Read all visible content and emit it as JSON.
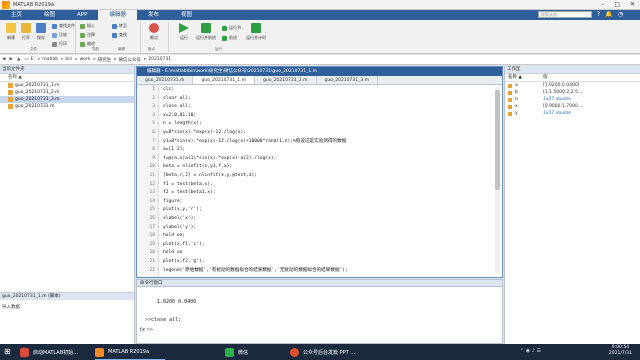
{
  "window": {
    "title": "MATLAB R2019a"
  },
  "ribbon": {
    "tabs": [
      "主页",
      "绘图",
      "APP",
      "编辑器",
      "发布",
      "视图"
    ],
    "active_tab": "编辑器",
    "search_placeholder": "搜索文档",
    "buttons": {
      "new": "新建",
      "open": "打开",
      "save": "保存",
      "find_files": "查找文件",
      "compare": "比较",
      "print": "打印",
      "insert": "插入",
      "comment": "注释",
      "indent": "缩进",
      "goto": "转至",
      "find": "查找",
      "breakpoint": "断点",
      "run": "运行",
      "run_advance": "运行并前进",
      "run_section": "运行节",
      "advance": "前进",
      "run_time": "运行并计时"
    },
    "groups": [
      "文件",
      "导航",
      "编辑",
      "断点",
      "运行"
    ]
  },
  "address": {
    "crumbs": [
      "E:",
      "matlab",
      "bin",
      "work",
      "研究生",
      "微信公众号",
      "20210731"
    ]
  },
  "left_panel": {
    "title": "当前文件夹",
    "column": "名称 ▲",
    "files": [
      {
        "name": "guo_20210731_1.m",
        "selected": false
      },
      {
        "name": "guo_20210731_2.m",
        "selected": false
      },
      {
        "name": "guo_20210731_3.m",
        "selected": true
      },
      {
        "name": "guo_20210731.m",
        "selected": false
      }
    ],
    "detail_title": "guo_20210731_1.m (脚本)",
    "detail_body": "导入数据"
  },
  "editor": {
    "title": "编辑器 - E:\\matlab\\bin\\work\\研究生\\微信公众号\\20210731\\guo_20210731_1.m",
    "tabs": [
      "guo_20210731.m",
      "guo_20210731_1.m",
      "guo_20210731_2.m",
      "guo_20210731_3.m"
    ],
    "active_tab": 1,
    "lines": [
      {
        "n": "1",
        "t": "clc;"
      },
      {
        "n": "2",
        "t": "clear all;"
      },
      {
        "n": "3",
        "t": "close all;"
      },
      {
        "n": "4",
        "t": "x=2:0.01:10;"
      },
      {
        "n": "5",
        "t": "n = length(x);"
      },
      {
        "n": "6",
        "t": "y=8*sin(x).*exp(x)-12./log(x);"
      },
      {
        "n": "7",
        "t": "y1=8*sin(x).*exp(x)-12./log(x)+10000*rand(1,n);%假设这是实验测得的数据"
      },
      {
        "n": "8",
        "t": "a=[1 2];"
      },
      {
        "n": "9",
        "t": "f=@(a,x)a(1)*sin(x).*exp(x)-a(2)./log(x);"
      },
      {
        "n": "10",
        "t": "beta = nlinfit(x,y1,f,a);"
      },
      {
        "n": "11",
        "t": "[beta,r,J] = nlinfit(x,y,@test,a);"
      },
      {
        "n": "12",
        "t": "f1 = test(beta,x);"
      },
      {
        "n": "13",
        "t": "f2 = test(beta1,x);"
      },
      {
        "n": "14",
        "t": "figure;"
      },
      {
        "n": "15",
        "t": "plot(x,y,'r');"
      },
      {
        "n": "16",
        "t": "xlabel('x');"
      },
      {
        "n": "17",
        "t": "ylabel('y');"
      },
      {
        "n": "18",
        "t": "hold on;"
      },
      {
        "n": "19",
        "t": "plot(x,f1,'c');"
      },
      {
        "n": "20",
        "t": "hold on"
      },
      {
        "n": "21",
        "t": "plot(x,f2,'g');"
      },
      {
        "n": "22",
        "t": "legend('原始数据','有扰动的数据拟合的结果数据','无扰动的数据拟合的结果数据');"
      }
    ]
  },
  "command": {
    "title": "命令行窗口",
    "output": "1.0200    0.0400",
    "prompt": ">> ",
    "last_command": "close all;",
    "fx": "fx"
  },
  "workspace": {
    "title": "工作区",
    "col_name": "名称 ▲",
    "col_value": "值",
    "rows": [
      {
        "name": "a",
        "value": "[1.0200,0.0400]",
        "dim": false
      },
      {
        "name": "b",
        "value": "[1;1.5000;2;2.5...",
        "dim": false
      },
      {
        "name": "n",
        "value": "1x37 double",
        "dim": true
      },
      {
        "name": "x",
        "value": "[0.9000;1.7000...",
        "dim": false
      },
      {
        "name": "y",
        "value": "1x37 double",
        "dim": true
      }
    ]
  },
  "taskbar": {
    "items": [
      {
        "label": "启动MATLAB初始...",
        "color": "#d94b3b"
      },
      {
        "label": "MATLAB R2019a",
        "color": "#f08a24"
      },
      {
        "label": "微信",
        "color": "#2bb24c"
      },
      {
        "label": "公众号后台发篇 PPT ...",
        "color": "#e0522e"
      }
    ],
    "time": "9:00:54",
    "date": "2021/7/31"
  }
}
